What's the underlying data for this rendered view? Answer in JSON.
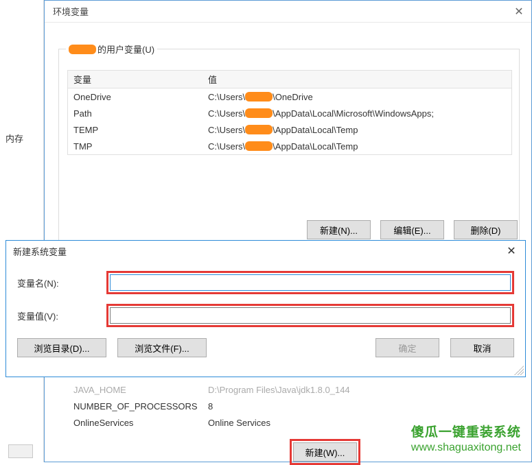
{
  "left_panel": {
    "label": "内存"
  },
  "main_window": {
    "title": "环境变量",
    "close_glyph": "✕"
  },
  "user_vars": {
    "group_label_suffix": "的用户变量(U)",
    "columns": {
      "var": "变量",
      "val": "值"
    },
    "rows": [
      {
        "var": "OneDrive",
        "val_pre": "C:\\Users\\",
        "val_post": "\\OneDrive"
      },
      {
        "var": "Path",
        "val_pre": "C:\\Users\\",
        "val_post": "\\AppData\\Local\\Microsoft\\WindowsApps;"
      },
      {
        "var": "TEMP",
        "val_pre": "C:\\Users\\",
        "val_post": "\\AppData\\Local\\Temp"
      },
      {
        "var": "TMP",
        "val_pre": "C:\\Users\\",
        "val_post": "\\AppData\\Local\\Temp"
      }
    ],
    "buttons": {
      "new": "新建(N)...",
      "edit": "编辑(E)...",
      "delete": "删除(D)"
    }
  },
  "dialog2": {
    "title": "新建系统变量",
    "close_glyph": "✕",
    "name_label": "变量名(N):",
    "value_label": "变量值(V):",
    "name_value": "",
    "value_value": "",
    "buttons": {
      "browse_dir": "浏览目录(D)...",
      "browse_file": "浏览文件(F)...",
      "ok": "确定",
      "cancel": "取消"
    }
  },
  "sys_vars": {
    "rows": [
      {
        "var": "JAVA_HOME",
        "val": "D:\\Program Files\\Java\\jdk1.8.0_144"
      },
      {
        "var": "NUMBER_OF_PROCESSORS",
        "val": "8"
      },
      {
        "var": "OnlineServices",
        "val": "Online Services"
      }
    ],
    "new_button": "新建(W)..."
  },
  "watermark": {
    "line1": "傻瓜一键重装系统",
    "line2": "www.shaguaxitong.net"
  }
}
